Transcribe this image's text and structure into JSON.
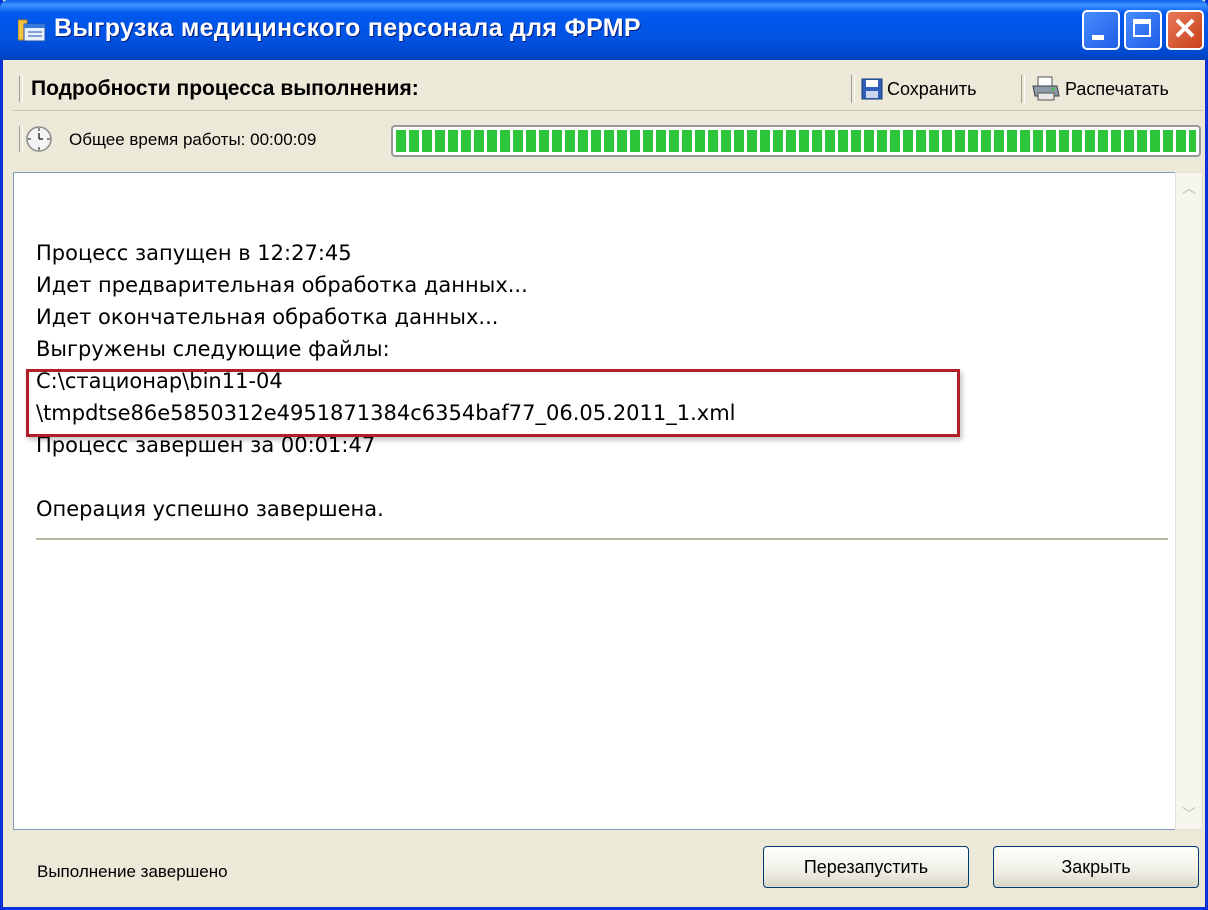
{
  "window": {
    "title": "Выгрузка медицинского персонала для ФРМР"
  },
  "header": {
    "title": "Подробности процесса выполнения:",
    "save_label": "Сохранить",
    "print_label": "Распечатать"
  },
  "status": {
    "elapsed_label": "Общее время работы: 00:00:09",
    "progress": 1.0
  },
  "log": {
    "lines": [
      "Процесс запущен в 12:27:45",
      "Идет предварительная обработка данных...",
      "Идет окончательная обработка данных...",
      "Выгружены следующие файлы:",
      "C:\\стационар\\bin11-04",
      "\\tmpdtse86e5850312e4951871384c6354baf77_06.05.2011_1.xml",
      "Процесс завершен за 00:01:47",
      "",
      "Операция успешно завершена."
    ]
  },
  "footer": {
    "status": "Выполнение завершено",
    "restart_label": "Перезапустить",
    "close_label": "Закрыть"
  },
  "colors": {
    "titlebar": "#0054E3",
    "progress": "#2DC63A",
    "highlight": "#B01E2A"
  }
}
